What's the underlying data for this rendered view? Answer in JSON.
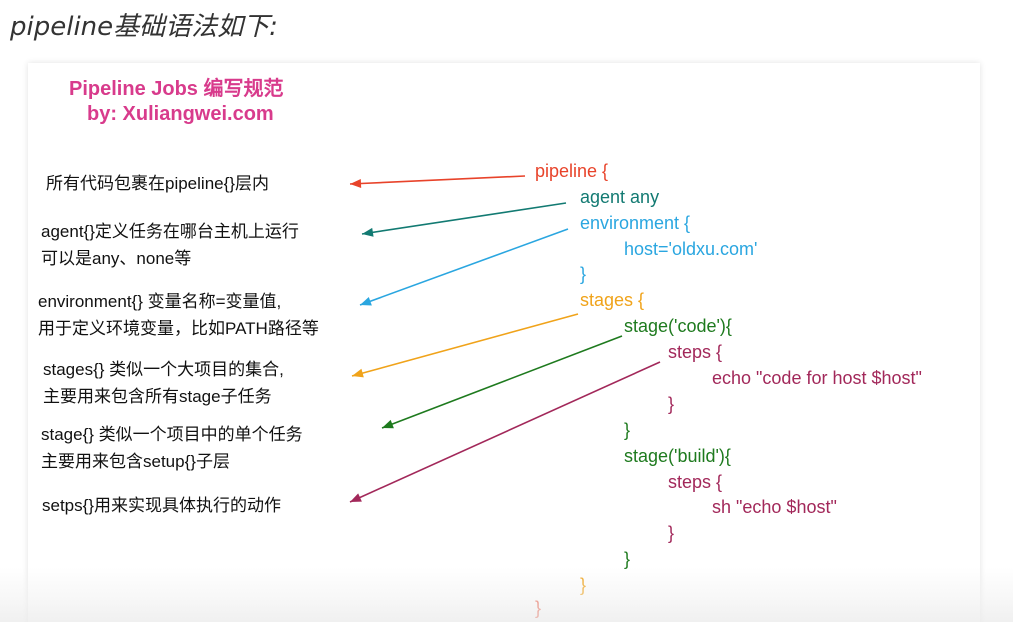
{
  "heading": "pipeline基础语法如下:",
  "title": {
    "line1": "Pipeline Jobs 编写规范",
    "line2": "by: Xuliangwei.com"
  },
  "notes": [
    {
      "line1": "所有代码包裹在pipeline{}层内",
      "line2": ""
    },
    {
      "line1": "agent{}定义任务在哪台主机上运行",
      "line2": "可以是any、none等"
    },
    {
      "line1": "environment{} 变量名称=变量值,",
      "line2": "用于定义环境变量，比如PATH路径等"
    },
    {
      "line1": "stages{} 类似一个大项目的集合,",
      "line2": "主要用来包含所有stage子任务"
    },
    {
      "line1": "stage{} 类似一个项目中的单个任务",
      "line2": "主要用来包含setup{}子层"
    },
    {
      "line1": "setps{}用来实现具体执行的动作",
      "line2": ""
    }
  ],
  "code": [
    {
      "text": "pipeline {",
      "color": "#e8432a"
    },
    {
      "text": "agent any",
      "color": "#127a72"
    },
    {
      "text": "environment {",
      "color": "#2aa6e0"
    },
    {
      "text": "host='oldxu.com'",
      "color": "#2aa6e0"
    },
    {
      "text": "}",
      "color": "#2aa6e0"
    },
    {
      "text": "stages {",
      "color": "#f0a31a"
    },
    {
      "text": "stage('code'){",
      "color": "#1e7a1e"
    },
    {
      "text": "steps {",
      "color": "#a2285a"
    },
    {
      "text": "echo \"code for host $host\"",
      "color": "#a2285a"
    },
    {
      "text": "}",
      "color": "#a2285a"
    },
    {
      "text": "}",
      "color": "#1e7a1e"
    },
    {
      "text": "stage('build'){",
      "color": "#1e7a1e"
    },
    {
      "text": "steps {",
      "color": "#a2285a"
    },
    {
      "text": "sh \"echo $host\"",
      "color": "#a2285a"
    },
    {
      "text": "}",
      "color": "#a2285a"
    },
    {
      "text": "}",
      "color": "#1e7a1e"
    },
    {
      "text": "}",
      "color": "#f0a31a"
    },
    {
      "text": "}",
      "color": "#e8432a"
    }
  ],
  "arrow_colors": [
    "#e8432a",
    "#127a72",
    "#2aa6e0",
    "#f0a31a",
    "#1e7a1e",
    "#a2285a"
  ]
}
